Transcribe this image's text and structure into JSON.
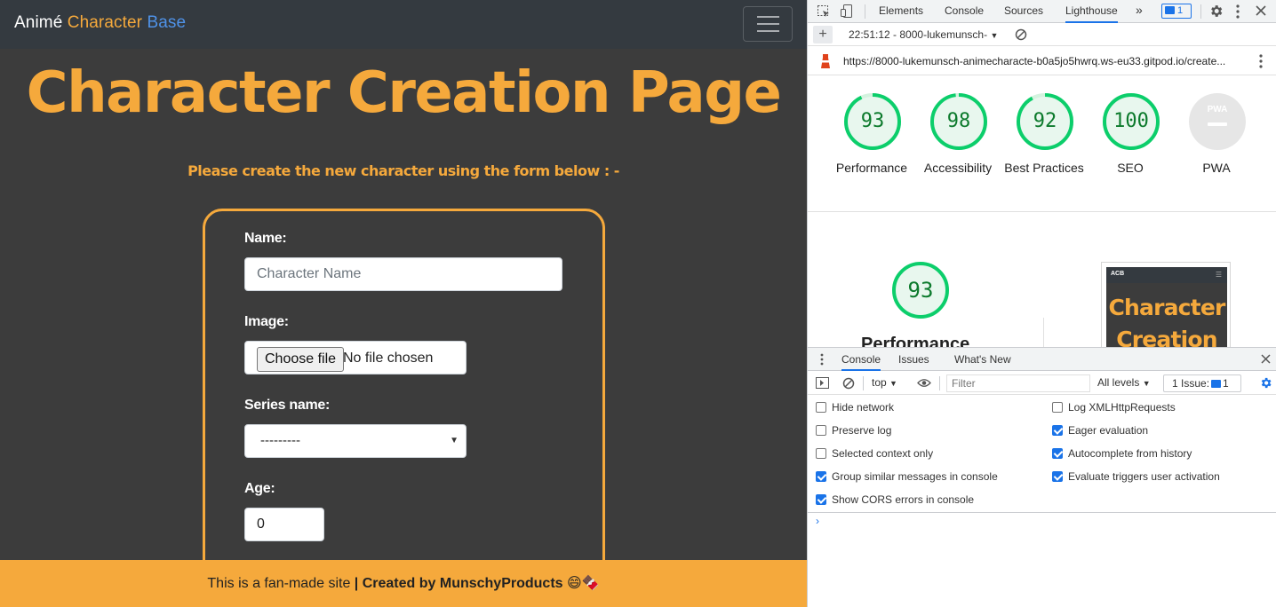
{
  "app": {
    "brand": [
      "Animé",
      "Character",
      "Base"
    ],
    "title": "Character Creation Page",
    "subtitle": "Please create the new character using the form below : -",
    "form": {
      "name_label": "Name:",
      "name_placeholder": "Character Name",
      "image_label": "Image:",
      "file_button": "Choose file",
      "file_status": "No file chosen",
      "series_label": "Series name:",
      "series_selected": "---------",
      "age_label": "Age:",
      "age_value": "0"
    },
    "footer": {
      "text": "This is a fan-made site",
      "separator": " | ",
      "credit": "Created by MunschyProducts",
      "emoji": "😄🍫"
    },
    "colors": {
      "accent": "#f5a93c",
      "brand_blue": "#4f92e8",
      "background": "#3c3c3c",
      "navbar": "#343a40"
    }
  },
  "devtools": {
    "tabs": [
      "Elements",
      "Console",
      "Sources",
      "Lighthouse"
    ],
    "active_tab": "Lighthouse",
    "more": "»",
    "issue_badge": "1",
    "report_label": "22:51:12 - 8000-lukemunsch-",
    "url": "https://8000-lukemunsch-animecharacte-b0a5jo5hwrq.ws-eu33.gitpod.io/create...",
    "scores": [
      {
        "label": "Performance",
        "value": 93
      },
      {
        "label": "Accessibility",
        "value": 98
      },
      {
        "label": "Best Practices",
        "value": 92
      },
      {
        "label": "SEO",
        "value": 100
      },
      {
        "label": "PWA",
        "value": null
      }
    ],
    "pwa_badge": "PWA",
    "detail": {
      "score": 93,
      "label": "Performance",
      "thumb_logo": "ACB",
      "thumb_title": "Character Creation"
    },
    "drawer": {
      "tabs": [
        "Console",
        "Issues",
        "What's New"
      ],
      "context": "top",
      "filter_placeholder": "Filter",
      "levels": "All levels",
      "issue_count": "1 Issue:",
      "issue_num": "1",
      "options_left": [
        {
          "label": "Hide network",
          "checked": false
        },
        {
          "label": "Preserve log",
          "checked": false
        },
        {
          "label": "Selected context only",
          "checked": false
        },
        {
          "label": "Group similar messages in console",
          "checked": true
        },
        {
          "label": "Show CORS errors in console",
          "checked": true
        }
      ],
      "options_right": [
        {
          "label": "Log XMLHttpRequests",
          "checked": false
        },
        {
          "label": "Eager evaluation",
          "checked": true
        },
        {
          "label": "Autocomplete from history",
          "checked": true
        },
        {
          "label": "Evaluate triggers user activation",
          "checked": true
        }
      ],
      "prompt": "›"
    },
    "colors": {
      "active": "#1a73e8",
      "pass": "#0c7a2c",
      "pass_ring": "#0cce6b"
    }
  }
}
